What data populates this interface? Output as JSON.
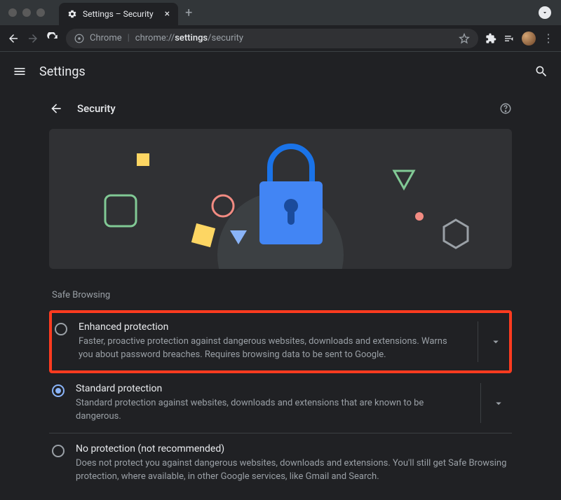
{
  "tab": {
    "title": "Settings – Security"
  },
  "omnibox": {
    "prefix": "Chrome",
    "scheme": "chrome://",
    "path_bold": "settings",
    "path_rest": "/security"
  },
  "settings_header": {
    "title": "Settings"
  },
  "page": {
    "back_label": "Security",
    "section": "Safe Browsing",
    "options": [
      {
        "title": "Enhanced protection",
        "desc": "Faster, proactive protection against dangerous websites, downloads and extensions. Warns you about password breaches. Requires browsing data to be sent to Google."
      },
      {
        "title": "Standard protection",
        "desc": "Standard protection against websites, downloads and extensions that are known to be dangerous."
      },
      {
        "title": "No protection (not recommended)",
        "desc": "Does not protect you against dangerous websites, downloads and extensions. You'll still get Safe Browsing protection, where available, in other Google services, like Gmail and Search."
      }
    ]
  }
}
